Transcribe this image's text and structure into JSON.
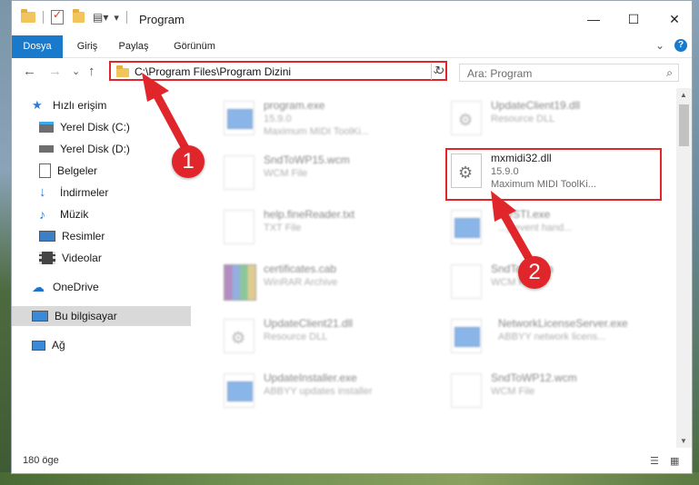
{
  "window": {
    "title": "Program",
    "minimize": "—",
    "maximize": "☐",
    "close": "✕"
  },
  "ribbon": {
    "tabs": [
      "Dosya",
      "Giriş",
      "Paylaş",
      "Görünüm"
    ],
    "expand": "⌄",
    "help": "?"
  },
  "nav": {
    "back": "←",
    "forward": "→",
    "recent": "⌄",
    "up": "↑",
    "address": "C:\\Program Files\\Program Dizini",
    "address_dropdown": "⌄",
    "refresh": "↻",
    "search_placeholder": "Ara: Program",
    "search_icon": "⌕"
  },
  "sidebar": {
    "items": [
      {
        "label": "Hızlı erişim",
        "icon": "star-icon",
        "pinned": false
      },
      {
        "label": "Yerel Disk (C:)",
        "icon": "drive-icon",
        "pinned": true
      },
      {
        "label": "Yerel Disk (D:)",
        "icon": "drive-icon",
        "pinned": false
      },
      {
        "label": "Belgeler",
        "icon": "documents-icon",
        "pinned": true
      },
      {
        "label": "İndirmeler",
        "icon": "downloads-icon",
        "pinned": true
      },
      {
        "label": "Müzik",
        "icon": "music-icon",
        "pinned": true
      },
      {
        "label": "Resimler",
        "icon": "pictures-icon",
        "pinned": true
      },
      {
        "label": "Videolar",
        "icon": "videos-icon",
        "pinned": true
      },
      {
        "label": "OneDrive",
        "icon": "cloud-icon",
        "pinned": false
      },
      {
        "label": "Bu bilgisayar",
        "icon": "computer-icon",
        "pinned": false
      },
      {
        "label": "Ağ",
        "icon": "network-icon",
        "pinned": false
      }
    ],
    "pin_glyph": "📌"
  },
  "files": [
    {
      "name": "program.exe",
      "line1": "15.9.0",
      "line2": "Maximum MIDI ToolKi...",
      "icon": "exe-icon",
      "focused": false
    },
    {
      "name": "UpdateClient19.dll",
      "line1": "Resource DLL",
      "line2": "",
      "icon": "dll-icon",
      "focused": false
    },
    {
      "name": "SndToWP15.wcm",
      "line1": "WCM File",
      "line2": "",
      "icon": "file-icon",
      "focused": false
    },
    {
      "name": "mxmidi32.dll",
      "line1": "15.9.0",
      "line2": "Maximum MIDI ToolKi...",
      "icon": "dll-icon",
      "focused": true
    },
    {
      "name": "help.fineReader.txt",
      "line1": "TXT File",
      "line2": "",
      "icon": "file-icon",
      "focused": false
    },
    {
      "name": "...ySTI.exe",
      "line1": "...y event hand...",
      "line2": "",
      "icon": "exe-icon",
      "focused": false
    },
    {
      "name": "certificates.cab",
      "line1": "WinRAR Archive",
      "line2": "",
      "icon": "archive-icon",
      "focused": false
    },
    {
      "name": "SndTo...wcm",
      "line1": "WCM F...",
      "line2": "",
      "icon": "file-icon",
      "focused": false
    },
    {
      "name": "UpdateClient21.dll",
      "line1": "Resource DLL",
      "line2": "",
      "icon": "dll-icon",
      "focused": false
    },
    {
      "name": "NetworkLicenseServer.exe",
      "line1": "ABBYY network licens...",
      "line2": "",
      "icon": "exe-icon",
      "focused": false
    },
    {
      "name": "UpdateInstaller.exe",
      "line1": "ABBYY updates installer",
      "line2": "",
      "icon": "exe-icon",
      "focused": false
    },
    {
      "name": "SndToWP12.wcm",
      "line1": "WCM File",
      "line2": "",
      "icon": "file-icon",
      "focused": false
    }
  ],
  "status": {
    "count": "180 öge",
    "details_view": "☰",
    "tiles_view": "▦"
  },
  "annotations": {
    "step1": "1",
    "step2": "2"
  },
  "colors": {
    "accent": "#1979ca",
    "highlight": "#e0262b"
  }
}
